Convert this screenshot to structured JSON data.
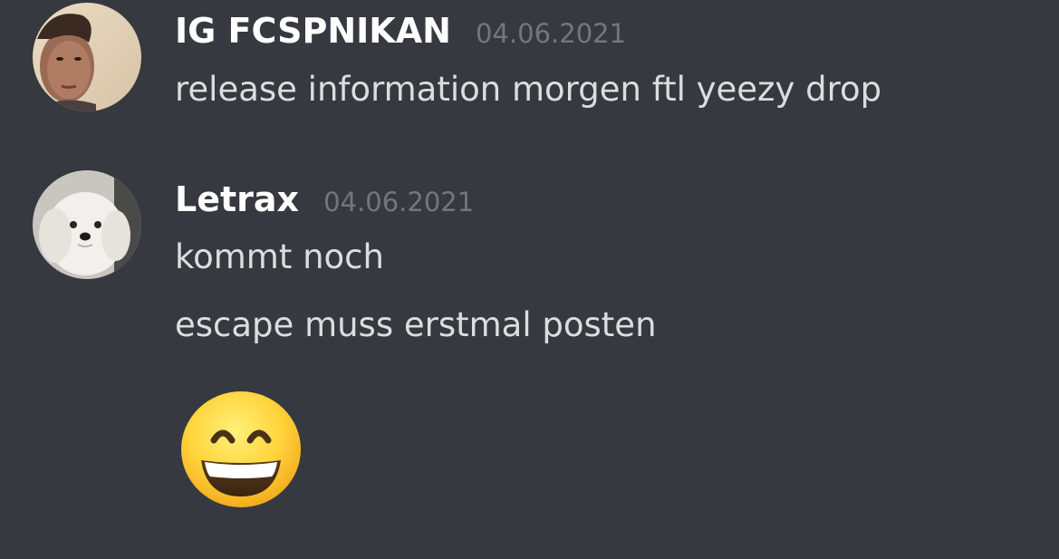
{
  "messages": [
    {
      "username": "IG FCSPNIKAN",
      "timestamp": "04.06.2021",
      "avatar_icon": "user-photo-avatar",
      "lines": [
        "release information morgen ftl yeezy drop"
      ]
    },
    {
      "username": "Letrax",
      "timestamp": "04.06.2021",
      "avatar_icon": "dog-photo-avatar",
      "lines": [
        "kommt noch",
        "escape muss erstmal posten"
      ],
      "emoji": "grinning-face-with-smiling-eyes"
    }
  ],
  "colors": {
    "background": "#36393f",
    "username": "#ffffff",
    "timestamp": "#72767d",
    "message_text": "#dcddde"
  }
}
